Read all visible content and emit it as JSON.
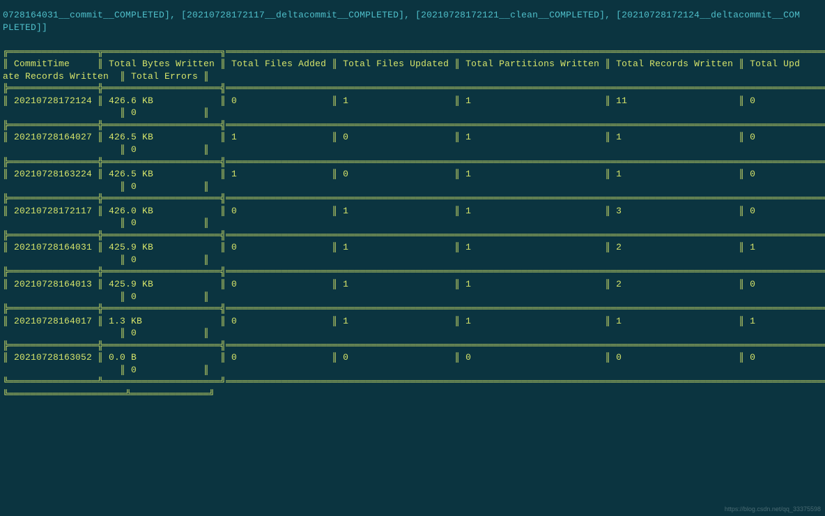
{
  "intro_line1": "0728164031__commit__COMPLETED], [20210728172117__deltacommit__COMPLETED], [20210728172121__clean__COMPLETED], [20210728172124__deltacommit__COM",
  "intro_line2": "PLETED]]",
  "columns": [
    "CommitTime",
    "Total Bytes Written",
    "Total Files Added",
    "Total Files Updated",
    "Total Partitions Written",
    "Total Records Written",
    "Total Update Records Written",
    "Total Errors"
  ],
  "rows": [
    {
      "commit": "20210728172124",
      "bytes": "426.6 KB",
      "added": "0",
      "updated": "1",
      "parts": "1",
      "records": "11",
      "upd": "0",
      "err": "0"
    },
    {
      "commit": "20210728164027",
      "bytes": "426.5 KB",
      "added": "1",
      "updated": "0",
      "parts": "1",
      "records": "1",
      "upd": "0",
      "err": "0"
    },
    {
      "commit": "20210728163224",
      "bytes": "426.5 KB",
      "added": "1",
      "updated": "0",
      "parts": "1",
      "records": "1",
      "upd": "0",
      "err": "0"
    },
    {
      "commit": "20210728172117",
      "bytes": "426.0 KB",
      "added": "0",
      "updated": "1",
      "parts": "1",
      "records": "3",
      "upd": "0",
      "err": "0"
    },
    {
      "commit": "20210728164031",
      "bytes": "425.9 KB",
      "added": "0",
      "updated": "1",
      "parts": "1",
      "records": "2",
      "upd": "1",
      "err": "0"
    },
    {
      "commit": "20210728164013",
      "bytes": "425.9 KB",
      "added": "0",
      "updated": "1",
      "parts": "1",
      "records": "2",
      "upd": "0",
      "err": "0"
    },
    {
      "commit": "20210728164017",
      "bytes": "1.3 KB",
      "added": "0",
      "updated": "1",
      "parts": "1",
      "records": "1",
      "upd": "1",
      "err": "0"
    },
    {
      "commit": "20210728163052",
      "bytes": "0.0 B",
      "added": "0",
      "updated": "0",
      "parts": "0",
      "records": "0",
      "upd": "0",
      "err": "0"
    }
  ],
  "watermark": "https://blog.csdn.net/qq_33375598"
}
